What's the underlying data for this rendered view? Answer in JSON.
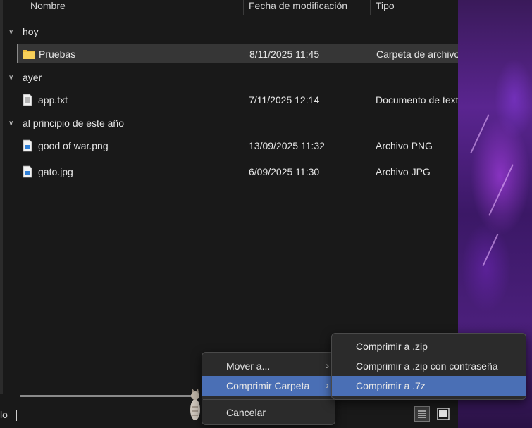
{
  "columns": {
    "name": "Nombre",
    "modified": "Fecha de modificación",
    "type": "Tipo"
  },
  "groups": [
    {
      "label": "hoy"
    },
    {
      "label": "ayer"
    },
    {
      "label": "al principio de este año"
    }
  ],
  "files": [
    {
      "name": "Pruebas",
      "date": "8/11/2025 11:45",
      "type": "Carpeta de archivos",
      "icon": "folder-icon"
    },
    {
      "name": "app.txt",
      "date": "7/11/2025 12:14",
      "type": "Documento de texto",
      "icon": "text-file-icon"
    },
    {
      "name": "good of war.png",
      "date": "13/09/2025 11:32",
      "type": "Archivo PNG",
      "icon": "image-file-icon"
    },
    {
      "name": "gato.jpg",
      "date": "6/09/2025 11:30",
      "type": "Archivo JPG",
      "icon": "image-file-icon"
    }
  ],
  "status": {
    "text": "lo"
  },
  "context_menu": {
    "items": [
      "Mover a...",
      "Comprimir Carpeta",
      "Cancelar"
    ],
    "highlighted": "Comprimir Carpeta"
  },
  "submenu": {
    "items": [
      "Comprimir a .zip",
      "Comprimir a .zip con contraseña",
      "Comprimir a .7z"
    ],
    "highlighted": "Comprimir a .7z"
  },
  "colors": {
    "highlight": "#4a6fb5",
    "folder": "#f0c040",
    "background": "#191919"
  }
}
